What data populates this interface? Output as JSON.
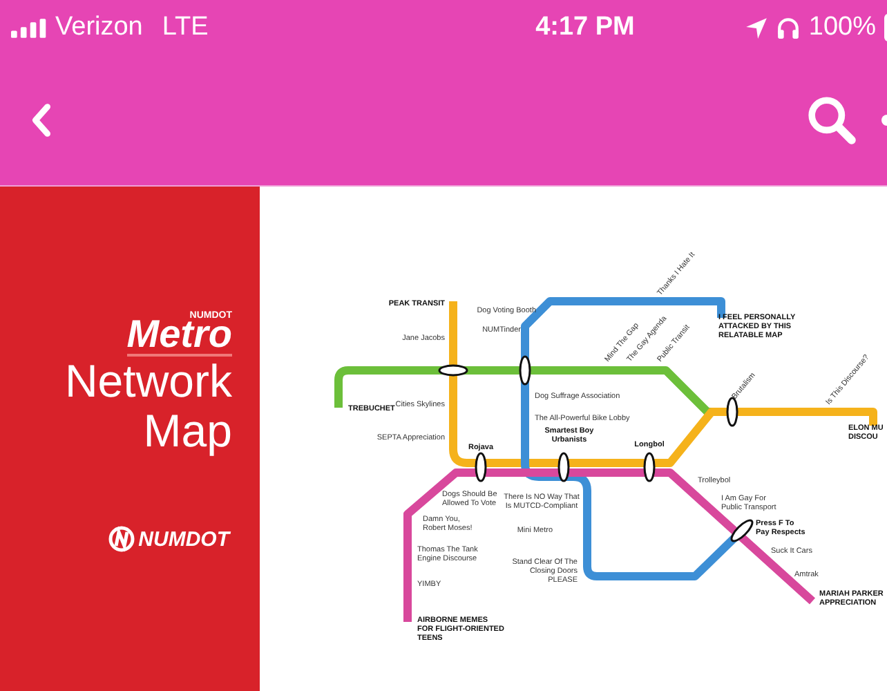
{
  "status_bar": {
    "carrier": "Verizon",
    "network": "LTE",
    "time": "4:17 PM",
    "battery": "100%"
  },
  "poster": {
    "brand_small": "NUMDOT",
    "title_1": "Metro",
    "title_2": "Network",
    "title_3": "Map",
    "logo": "NUMDOT"
  },
  "map": {
    "lines": [
      {
        "color": "#6cbf3a"
      },
      {
        "color": "#f5b21b"
      },
      {
        "color": "#3d8fd6"
      },
      {
        "color": "#d8489c"
      }
    ],
    "stations": [
      {
        "kind": "terminus",
        "text_lines": [
          "PEAK TRANSIT"
        ]
      },
      {
        "kind": "stop",
        "text_lines": [
          "Jane Jacobs"
        ]
      },
      {
        "kind": "stop",
        "text_lines": [
          "Cities Skylines"
        ]
      },
      {
        "kind": "stop",
        "text_lines": [
          "SEPTA Appreciation"
        ]
      },
      {
        "kind": "terminus",
        "text_lines": [
          "TREBUCHET"
        ]
      },
      {
        "kind": "stop",
        "text_lines": [
          "Dog Voting Booth"
        ]
      },
      {
        "kind": "stop",
        "text_lines": [
          "NUMTinder"
        ]
      },
      {
        "kind": "stop",
        "text_lines": [
          "Dog Suffrage Association"
        ]
      },
      {
        "kind": "stop",
        "text_lines": [
          "The All-Powerful Bike Lobby"
        ]
      },
      {
        "kind": "interchange",
        "text_lines": [
          "Smartest Boy",
          "Urbanists"
        ]
      },
      {
        "kind": "interchange",
        "text_lines": [
          "Rojava"
        ]
      },
      {
        "kind": "interchange",
        "text_lines": [
          "Longbol"
        ]
      },
      {
        "kind": "stop",
        "text_lines": [
          "Dogs Should Be",
          "Allowed To Vote"
        ]
      },
      {
        "kind": "stop",
        "text_lines": [
          "Damn You,",
          "Robert Moses!"
        ]
      },
      {
        "kind": "stop",
        "text_lines": [
          "Thomas The Tank",
          "Engine Discourse"
        ]
      },
      {
        "kind": "stop",
        "text_lines": [
          "YIMBY"
        ]
      },
      {
        "kind": "terminus",
        "text_lines": [
          "AIRBORNE MEMES",
          "FOR FLIGHT-ORIENTED",
          "TEENS"
        ]
      },
      {
        "kind": "stop",
        "text_lines": [
          "There Is NO Way That",
          "Is MUTCD-Compliant"
        ]
      },
      {
        "kind": "stop",
        "text_lines": [
          "Mini Metro"
        ]
      },
      {
        "kind": "stop",
        "text_lines": [
          "Stand Clear Of The",
          "Closing Doors",
          "PLEASE"
        ]
      },
      {
        "kind": "stop",
        "text_lines": [
          "Trolleybol"
        ]
      },
      {
        "kind": "stop",
        "text_lines": [
          "I Am Gay For",
          "Public Transport"
        ]
      },
      {
        "kind": "interchange",
        "text_lines": [
          "Press F To",
          "Pay Respects"
        ]
      },
      {
        "kind": "stop",
        "text_lines": [
          "Suck It Cars"
        ]
      },
      {
        "kind": "stop",
        "text_lines": [
          "Amtrak"
        ]
      },
      {
        "kind": "terminus",
        "text_lines": [
          "MARIAH PARKER",
          "APPRECIATION"
        ]
      },
      {
        "kind": "terminus",
        "text_lines": [
          "I FEEL PERSONALLY",
          "ATTACKED BY THIS",
          "RELATABLE MAP"
        ]
      },
      {
        "kind": "terminus",
        "text_lines": [
          "ELON MU",
          "DISCOU"
        ]
      },
      {
        "kind": "angled",
        "text_lines": [
          "Mind The Gap"
        ]
      },
      {
        "kind": "angled",
        "text_lines": [
          "The Gay Agenda"
        ]
      },
      {
        "kind": "angled",
        "text_lines": [
          "Public Transit"
        ]
      },
      {
        "kind": "angled",
        "text_lines": [
          "Thanks I Hate It"
        ]
      },
      {
        "kind": "angled",
        "text_lines": [
          "Brutalism"
        ]
      },
      {
        "kind": "angled",
        "text_lines": [
          "Is This Discourse?"
        ]
      }
    ]
  }
}
